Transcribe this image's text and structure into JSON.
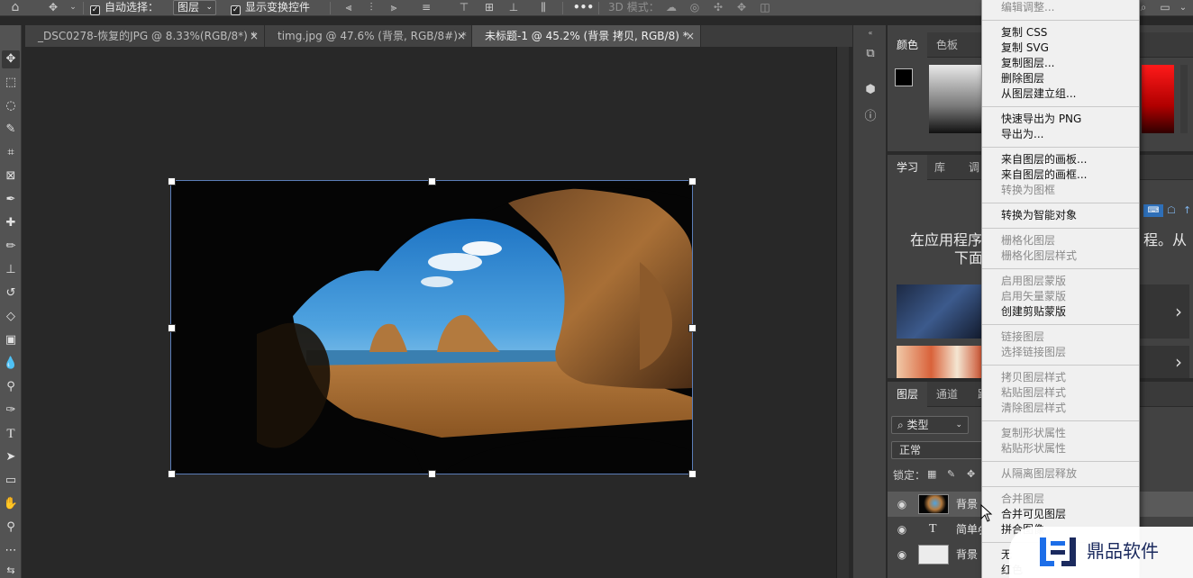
{
  "options_bar": {
    "auto_select_label": "自动选择：",
    "auto_select_checked": "✓",
    "auto_select_target": "图层",
    "show_transform_label": "显示变换控件",
    "show_transform_checked": "✓",
    "more_label": "•••",
    "mode_3d_label": "3D 模式："
  },
  "tabs": [
    {
      "label": "_DSC0278-恢复的JPG @ 8.33%(RGB/8*) *",
      "close": "×"
    },
    {
      "label": "timg.jpg @ 47.6% (背景, RGB/8#) *",
      "close": "×"
    },
    {
      "label": "未标题-1 @ 45.2% (背景 拷贝, RGB/8) *",
      "close": "×"
    }
  ],
  "panels": {
    "color_tabs": [
      "颜色",
      "色板"
    ],
    "learn_tabs": [
      "学习",
      "库",
      "调"
    ],
    "learn_title_line1": "在应用程序",
    "learn_title_right": "程。从",
    "learn_title_line2": "下面",
    "layers_tabs": [
      "图层",
      "通道",
      "路"
    ],
    "filter_kind": "类型",
    "blend_mode": "正常",
    "lock_label": "锁定：",
    "layers": [
      {
        "name": "背景"
      },
      {
        "name": "简单ጷ"
      },
      {
        "name": "背景"
      }
    ],
    "text_layer_icon": "T"
  },
  "context_menu": {
    "items": [
      {
        "label": "编辑调整...",
        "disabled": true
      },
      {
        "label": "复制 CSS",
        "disabled": false
      },
      {
        "label": "复制 SVG",
        "disabled": false
      },
      {
        "label": "复制图层...",
        "disabled": false
      },
      {
        "label": "删除图层",
        "disabled": false
      },
      {
        "label": "从图层建立组...",
        "disabled": false
      },
      {
        "label": "快速导出为 PNG",
        "disabled": false
      },
      {
        "label": "导出为...",
        "disabled": false
      },
      {
        "label": "来自图层的画板...",
        "disabled": false
      },
      {
        "label": "来自图层的画框...",
        "disabled": false
      },
      {
        "label": "转换为图框",
        "disabled": true
      },
      {
        "label": "转换为智能对象",
        "disabled": false
      },
      {
        "label": "栅格化图层",
        "disabled": true
      },
      {
        "label": "栅格化图层样式",
        "disabled": true
      },
      {
        "label": "启用图层蒙版",
        "disabled": true
      },
      {
        "label": "启用矢量蒙版",
        "disabled": true
      },
      {
        "label": "创建剪贴蒙版",
        "disabled": false
      },
      {
        "label": "链接图层",
        "disabled": true
      },
      {
        "label": "选择链接图层",
        "disabled": true
      },
      {
        "label": "拷贝图层样式",
        "disabled": true
      },
      {
        "label": "粘贴图层样式",
        "disabled": true
      },
      {
        "label": "清除图层样式",
        "disabled": true
      },
      {
        "label": "复制形状属性",
        "disabled": true
      },
      {
        "label": "粘贴形状属性",
        "disabled": true
      },
      {
        "label": "从隔离图层释放",
        "disabled": true
      },
      {
        "label": "合并图层",
        "disabled": true
      },
      {
        "label": "合并可见图层",
        "disabled": false
      },
      {
        "label": "拼合图像",
        "disabled": false
      },
      {
        "label": "无",
        "disabled": false
      },
      {
        "label": "红色",
        "disabled": false
      }
    ]
  },
  "watermark": {
    "text": "鼎品软件"
  },
  "colors": {
    "accent_selection": "#5b7db8",
    "menu_background": "#f0f0f0",
    "panel_background": "#424242"
  }
}
